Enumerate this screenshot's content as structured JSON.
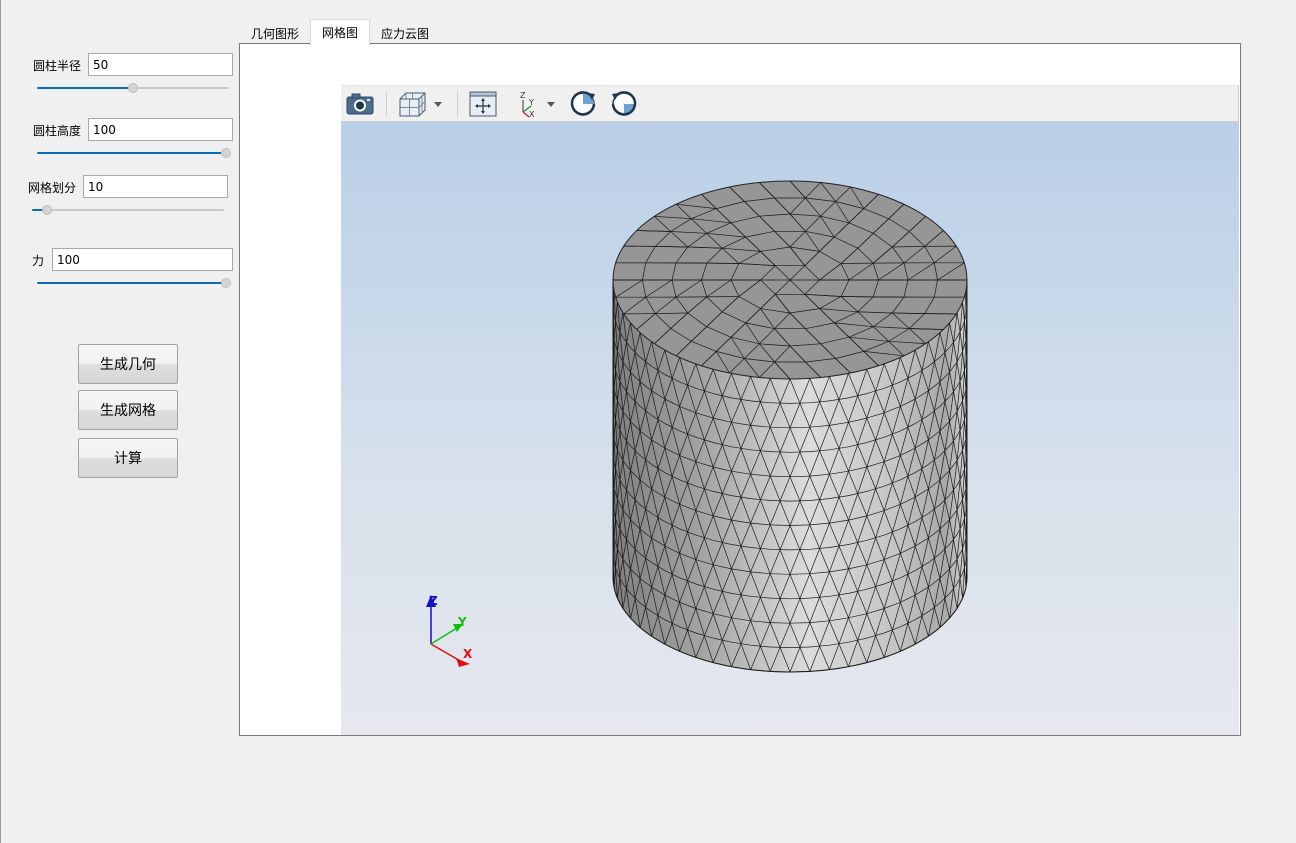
{
  "params": [
    {
      "label": "圆柱半径",
      "value": "50",
      "slider_fraction": 0.5
    },
    {
      "label": "圆柱高度",
      "value": "100",
      "slider_fraction": 1.0
    },
    {
      "label": "网格划分",
      "value": "10",
      "slider_fraction": 0.08
    },
    {
      "label": "力",
      "value": "100",
      "slider_fraction": 1.0
    }
  ],
  "buttons": {
    "generate_geometry": "生成几何",
    "generate_mesh": "生成网格",
    "compute": "计算"
  },
  "tabs": [
    {
      "label": "几何图形",
      "active": false
    },
    {
      "label": "网格图",
      "active": true
    },
    {
      "label": "应力云图",
      "active": false
    }
  ],
  "toolbar": {
    "icons": [
      "camera-icon",
      "view-cube-icon",
      "fit-all-icon",
      "axes-orientation-icon",
      "rotate-cw-icon",
      "rotate-ccw-icon"
    ]
  },
  "axes": {
    "x": "X",
    "y": "Y",
    "z": "Z"
  },
  "colors": {
    "accent": "#0a6cbd",
    "axis_x": "#e01010",
    "axis_y": "#10c010",
    "axis_z": "#1010d0",
    "mesh_fill": "#c8c8c8"
  }
}
